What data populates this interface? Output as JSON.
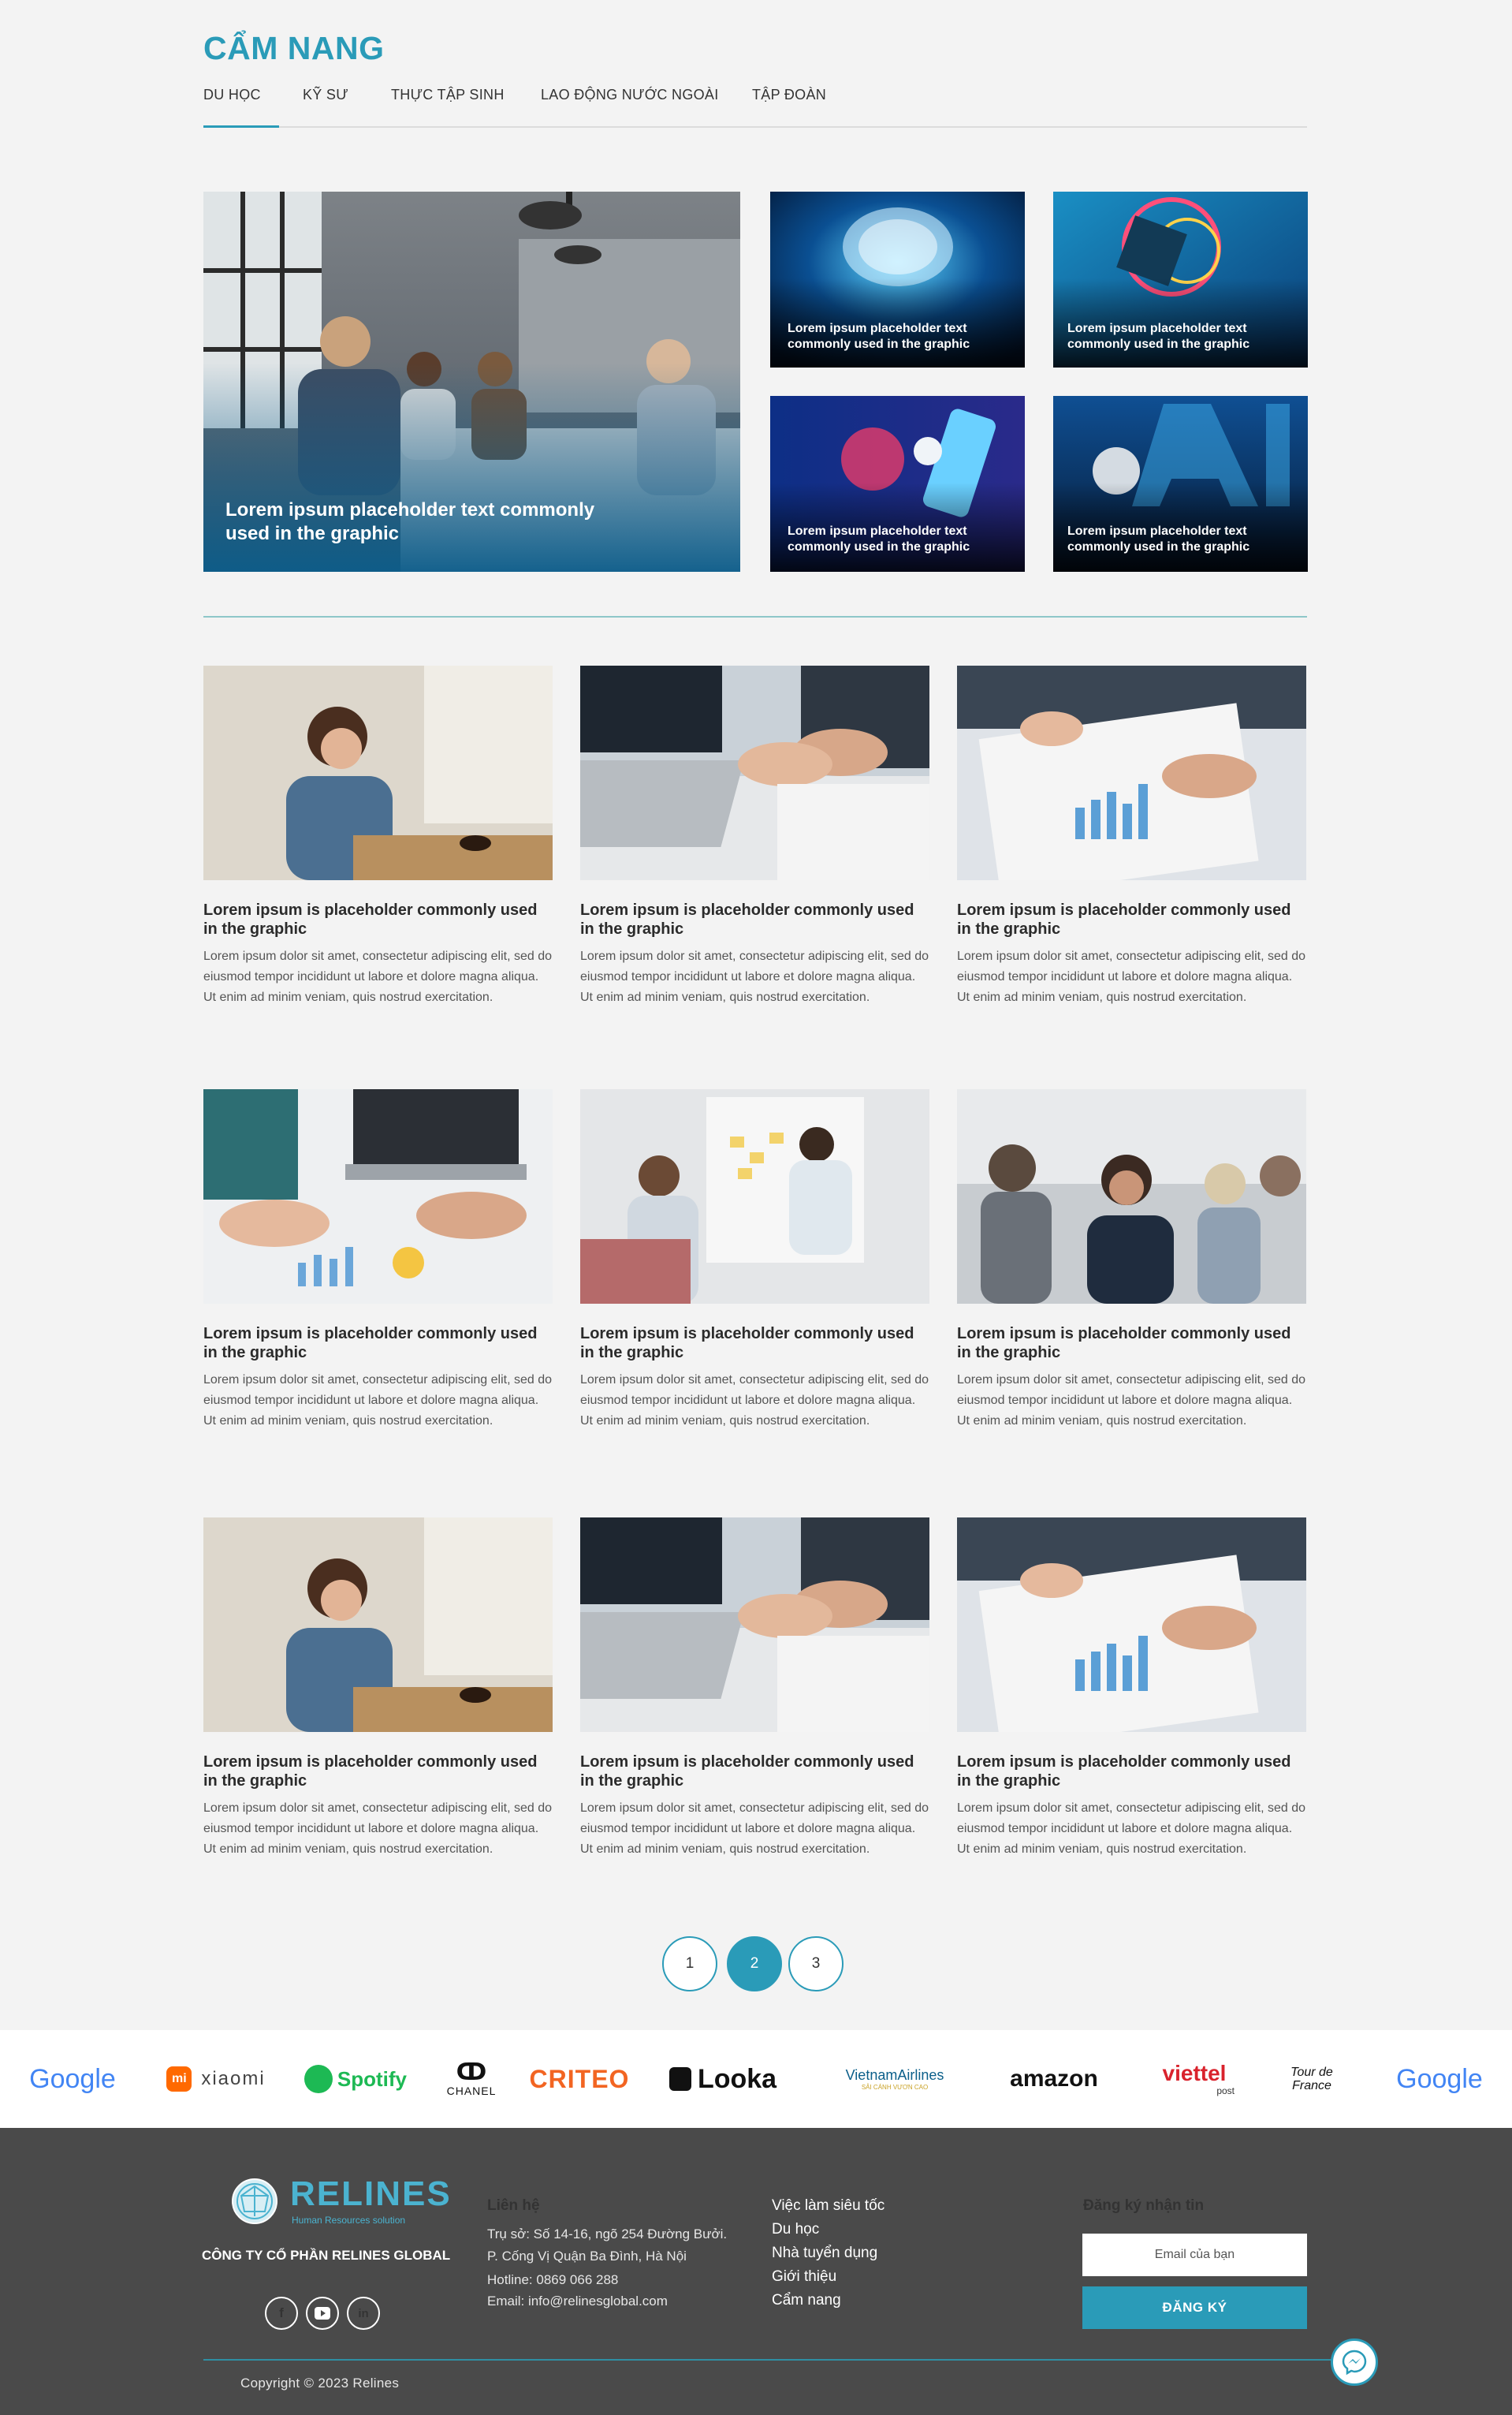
{
  "page": {
    "title": "CẨM NANG"
  },
  "tabs": [
    {
      "label": "DU HỌC"
    },
    {
      "label": "KỸ SƯ"
    },
    {
      "label": "THỰC TẬP SINH"
    },
    {
      "label": "LAO ĐỘNG NƯỚC NGOÀI"
    },
    {
      "label": "TẬP ĐOÀN"
    }
  ],
  "featured": {
    "main_caption": "Lorem ipsum placeholder text commonly used in the graphic",
    "small": [
      {
        "caption": "Lorem ipsum placeholder text commonly used in the graphic"
      },
      {
        "caption": "Lorem ipsum placeholder text commonly used in the graphic"
      },
      {
        "caption": "Lorem ipsum placeholder text commonly used in the graphic"
      },
      {
        "caption": "Lorem ipsum placeholder text commonly used in the graphic"
      }
    ]
  },
  "articles": [
    {
      "title": "Lorem ipsum is placeholder commonly used in the graphic",
      "excerpt": "Lorem ipsum dolor sit amet, consectetur adipiscing elit, sed do eiusmod tempor incididunt ut labore et dolore magna aliqua. Ut enim ad minim veniam, quis nostrud exercitation."
    },
    {
      "title": "Lorem ipsum is placeholder commonly used in the graphic",
      "excerpt": "Lorem ipsum dolor sit amet, consectetur adipiscing elit, sed do eiusmod tempor incididunt ut labore et dolore magna aliqua. Ut enim ad minim veniam, quis nostrud exercitation."
    },
    {
      "title": "Lorem ipsum is placeholder commonly used in the graphic",
      "excerpt": "Lorem ipsum dolor sit amet, consectetur adipiscing elit, sed do eiusmod tempor incididunt ut labore et dolore magna aliqua. Ut enim ad minim veniam, quis nostrud exercitation."
    },
    {
      "title": "Lorem ipsum is placeholder commonly used in the graphic",
      "excerpt": "Lorem ipsum dolor sit amet, consectetur adipiscing elit, sed do eiusmod tempor incididunt ut labore et dolore magna aliqua. Ut enim ad minim veniam, quis nostrud exercitation."
    },
    {
      "title": "Lorem ipsum is placeholder commonly used in the graphic",
      "excerpt": "Lorem ipsum dolor sit amet, consectetur adipiscing elit, sed do eiusmod tempor incididunt ut labore et dolore magna aliqua. Ut enim ad minim veniam, quis nostrud exercitation."
    },
    {
      "title": "Lorem ipsum is placeholder commonly used in the graphic",
      "excerpt": "Lorem ipsum dolor sit amet, consectetur adipiscing elit, sed do eiusmod tempor incididunt ut labore et dolore magna aliqua. Ut enim ad minim veniam, quis nostrud exercitation."
    },
    {
      "title": "Lorem ipsum is placeholder commonly used in the graphic",
      "excerpt": "Lorem ipsum dolor sit amet, consectetur adipiscing elit, sed do eiusmod tempor incididunt ut labore et dolore magna aliqua. Ut enim ad minim veniam, quis nostrud exercitation."
    },
    {
      "title": "Lorem ipsum is placeholder commonly used in the graphic",
      "excerpt": "Lorem ipsum dolor sit amet, consectetur adipiscing elit, sed do eiusmod tempor incididunt ut labore et dolore magna aliqua. Ut enim ad minim veniam, quis nostrud exercitation."
    },
    {
      "title": "Lorem ipsum is placeholder commonly used in the graphic",
      "excerpt": "Lorem ipsum dolor sit amet, consectetur adipiscing elit, sed do eiusmod tempor incididunt ut labore et dolore magna aliqua. Ut enim ad minim veniam, quis nostrud exercitation."
    }
  ],
  "pagination": {
    "pages": [
      "1",
      "2",
      "3"
    ],
    "current": "2"
  },
  "brands": [
    "Google",
    "xiaomi",
    "Spotify",
    "CHANEL",
    "CRITEO",
    "Looka",
    "VietnamAirlines",
    "SẢI CÁNH VƯƠN CAO",
    "amazon",
    "viettel",
    "post",
    "Tour de France",
    "Google"
  ],
  "footer": {
    "logo_text": "RELINES",
    "logo_tagline": "Human Resources solution",
    "company": "CÔNG TY CỔ PHẦN RELINES GLOBAL",
    "contact_title": "Liên hệ",
    "address_1": "Trụ sở: Số 14-16, ngõ 254 Đường Bưởi.",
    "address_2": "P. Cống Vị Quận Ba Đình, Hà Nội",
    "hotline": "Hotline: 0869 066 288",
    "email": "Email: info@relinesglobal.com",
    "links": [
      "Việc làm siêu tốc",
      "Du học",
      "Nhà tuyển dụng",
      "Giới thiệu",
      "Cẩm nang"
    ],
    "newsletter_title": "Đăng ký nhận tin",
    "email_placeholder": "Email của bạn",
    "subscribe_label": "ĐĂNG KÝ",
    "copyright": "Copyright © 2023 Relines"
  },
  "colors": {
    "accent": "#2a9bb8",
    "footer_bg": "#4a4a4a",
    "divider": "#8ec7c9"
  },
  "icons": [
    "facebook-icon",
    "youtube-icon",
    "linkedin-icon",
    "messenger-icon"
  ]
}
